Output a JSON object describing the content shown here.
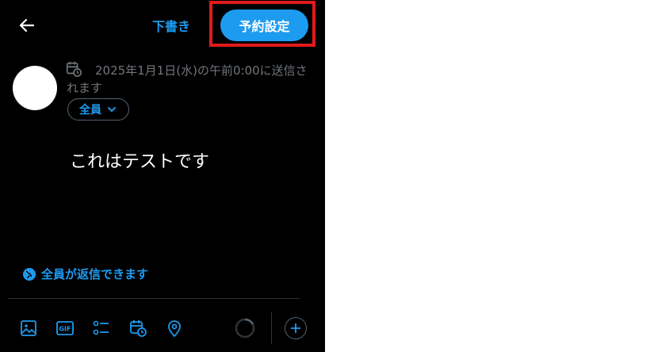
{
  "header": {
    "back_icon": "arrow-left-icon",
    "draft_label": "下書き",
    "schedule_label": "予約設定"
  },
  "compose": {
    "schedule_notice": "2025年1月1日(水)の午前0:00に送信されます",
    "audience_label": "全員",
    "post_text": "これはテストです",
    "reply_setting_label": "全員が返信できます"
  },
  "toolbar": {
    "icons": [
      "image-icon",
      "gif-icon",
      "poll-icon",
      "schedule-icon",
      "location-icon"
    ],
    "gif_text": "GIF"
  },
  "colors": {
    "accent": "#1d9bf0",
    "background": "#000000",
    "highlight": "#e01b1b",
    "muted": "#71767b"
  }
}
